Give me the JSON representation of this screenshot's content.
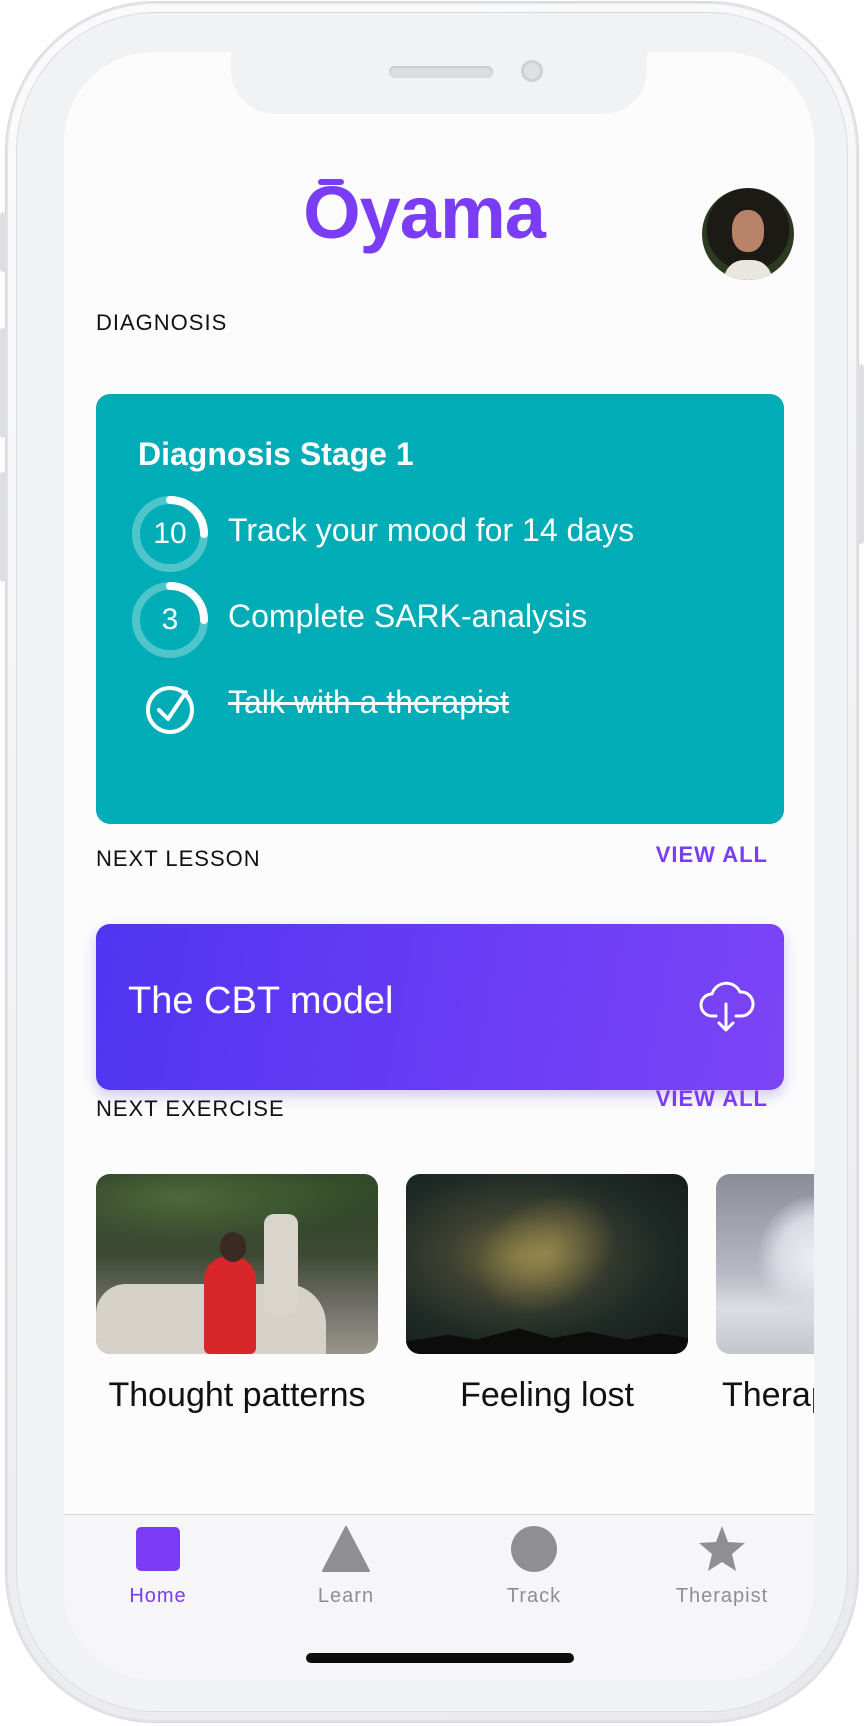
{
  "app": {
    "logo_text": "Oyama",
    "brand_color": "#7a3cf5",
    "diagnosis_color": "#00acb5"
  },
  "diagnosis": {
    "section_label": "DIAGNOSIS",
    "card_title": "Diagnosis Stage 1",
    "tasks": [
      {
        "badge": "10",
        "label": "Track your mood for 14 days",
        "completed": false,
        "progress": 0.29
      },
      {
        "badge": "3",
        "label": "Complete SARK-analysis",
        "completed": false,
        "progress": 0.29
      },
      {
        "badge": "check-icon",
        "label": "Talk with a therapist",
        "completed": true
      }
    ]
  },
  "next_lesson": {
    "section_label": "NEXT LESSON",
    "view_all_label": "VIEW ALL",
    "title": "The CBT model",
    "icon": "cloud-download-icon"
  },
  "next_exercise": {
    "section_label": "NEXT EXERCISE",
    "view_all_label": "VIEW ALL",
    "items": [
      {
        "title": "Thought patterns",
        "image": "woman-red-dress-on-driftwood"
      },
      {
        "title": "Feeling lost",
        "image": "milky-way-night-sky"
      },
      {
        "title": "Therap",
        "image": "frosted-tree-winter"
      }
    ]
  },
  "tabbar": {
    "items": [
      {
        "label": "Home",
        "icon": "square-icon",
        "active": true
      },
      {
        "label": "Learn",
        "icon": "triangle-icon",
        "active": false
      },
      {
        "label": "Track",
        "icon": "circle-icon",
        "active": false
      },
      {
        "label": "Therapist",
        "icon": "star-icon",
        "active": false
      }
    ]
  }
}
